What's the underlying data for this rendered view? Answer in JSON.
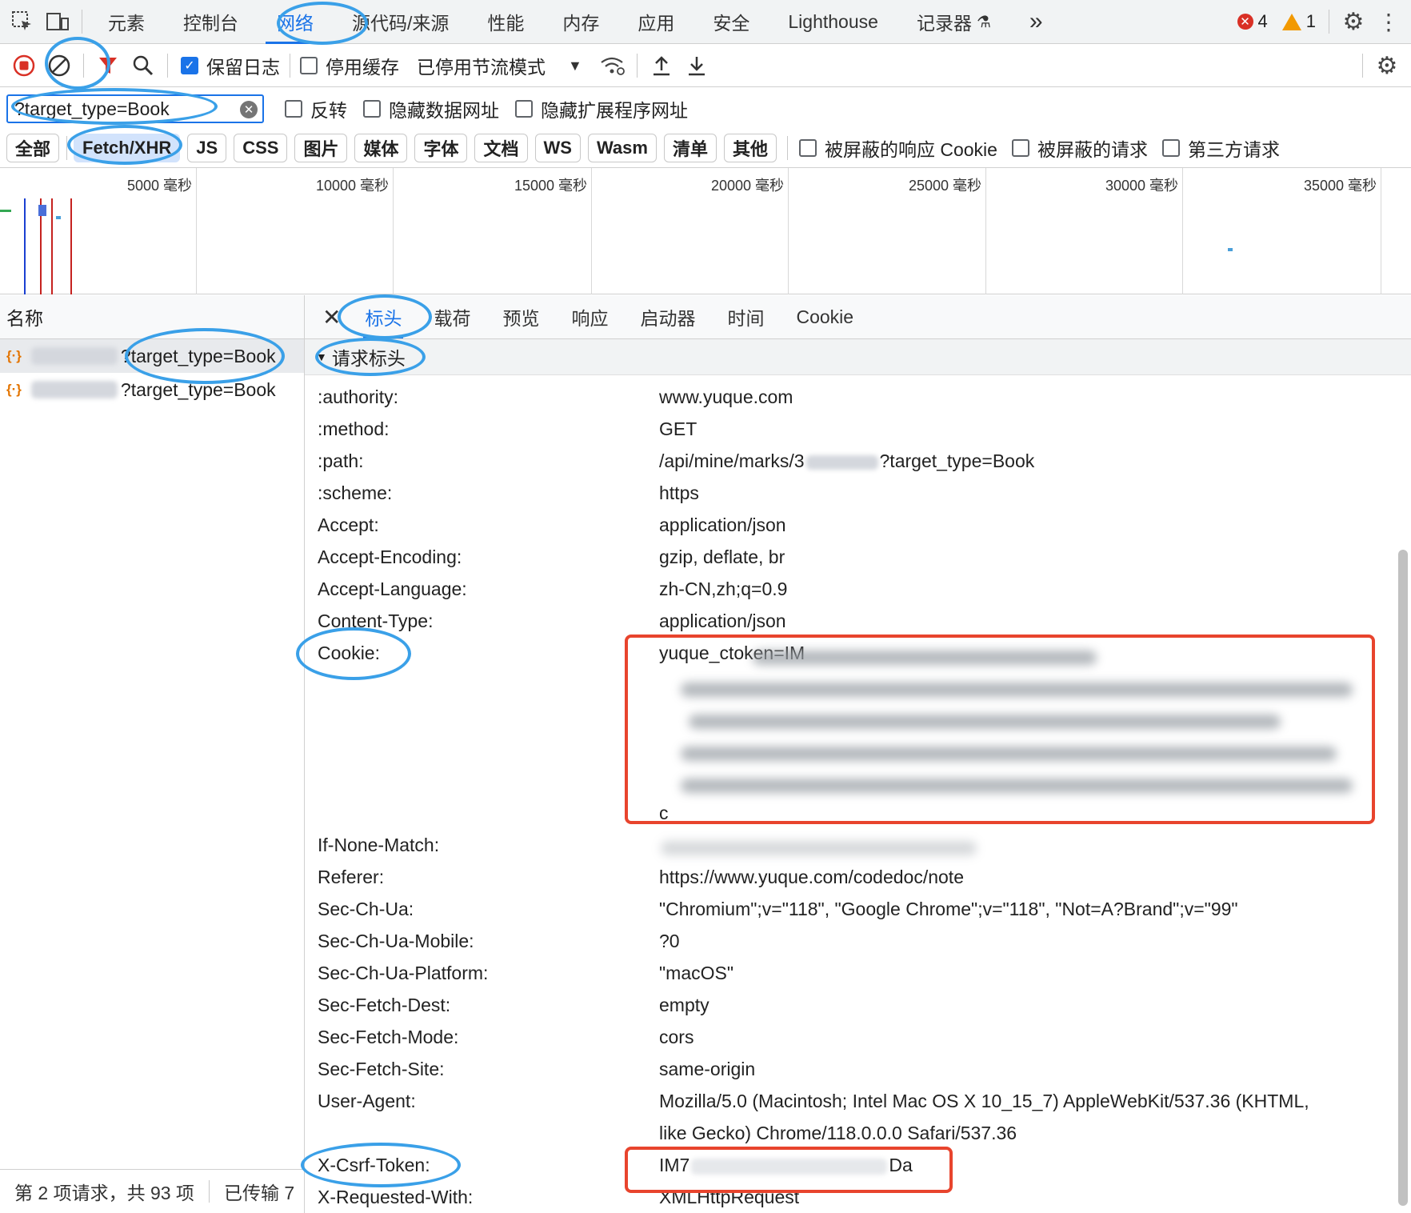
{
  "topbar": {
    "tabs": [
      "元素",
      "控制台",
      "网络",
      "源代码/来源",
      "性能",
      "内存",
      "应用",
      "安全",
      "Lighthouse",
      "记录器"
    ],
    "active_tab": "网络",
    "more": "»",
    "error_count": "4",
    "warning_count": "1"
  },
  "toolbar": {
    "preserve_log": "保留日志",
    "disable_cache": "停用缓存",
    "throttling": "已停用节流模式"
  },
  "filter": {
    "value": "?target_type=Book",
    "invert": "反转",
    "hide_data_urls": "隐藏数据网址",
    "hide_ext_urls": "隐藏扩展程序网址"
  },
  "types": {
    "chips": [
      "全部",
      "Fetch/XHR",
      "JS",
      "CSS",
      "图片",
      "媒体",
      "字体",
      "文档",
      "WS",
      "Wasm",
      "清单",
      "其他"
    ],
    "active": "Fetch/XHR",
    "blocked_cookies": "被屏蔽的响应 Cookie",
    "blocked_requests": "被屏蔽的请求",
    "third_party": "第三方请求"
  },
  "overview": {
    "ticks": [
      "5000 毫秒",
      "10000 毫秒",
      "15000 毫秒",
      "20000 毫秒",
      "25000 毫秒",
      "30000 毫秒",
      "35000 毫秒"
    ]
  },
  "left_panel": {
    "header": "名称",
    "requests": [
      {
        "name": "?target_type=Book"
      },
      {
        "name": "?target_type=Book"
      }
    ],
    "status": "第 2 项请求，共 93 项",
    "transferred": "已传输 7"
  },
  "details": {
    "tabs": [
      "标头",
      "载荷",
      "预览",
      "响应",
      "启动器",
      "时间",
      "Cookie"
    ],
    "active_tab": "标头",
    "section": "请求标头",
    "headers": [
      {
        "name": ":authority:",
        "value": "www.yuque.com"
      },
      {
        "name": ":method:",
        "value": "GET"
      },
      {
        "name": ":path:",
        "value": "/api/mine/marks/3"
      },
      {
        "name": ":scheme:",
        "value": "https"
      },
      {
        "name": "Accept:",
        "value": "application/json"
      },
      {
        "name": "Accept-Encoding:",
        "value": "gzip, deflate, br"
      },
      {
        "name": "Accept-Language:",
        "value": "zh-CN,zh;q=0.9"
      },
      {
        "name": "Content-Type:",
        "value": "application/json"
      },
      {
        "name": "Cookie:",
        "value": "yuque_ctoken=IM"
      },
      {
        "name": "If-None-Match:",
        "value": ""
      },
      {
        "name": "Referer:",
        "value": "https://www.yuque.com/codedoc/note"
      },
      {
        "name": "Sec-Ch-Ua:",
        "value": "\"Chromium\";v=\"118\", \"Google Chrome\";v=\"118\", \"Not=A?Brand\";v=\"99\""
      },
      {
        "name": "Sec-Ch-Ua-Mobile:",
        "value": "?0"
      },
      {
        "name": "Sec-Ch-Ua-Platform:",
        "value": "\"macOS\""
      },
      {
        "name": "Sec-Fetch-Dest:",
        "value": "empty"
      },
      {
        "name": "Sec-Fetch-Mode:",
        "value": "cors"
      },
      {
        "name": "Sec-Fetch-Site:",
        "value": "same-origin"
      },
      {
        "name": "User-Agent:",
        "value": "Mozilla/5.0 (Macintosh; Intel Mac OS X 10_15_7) AppleWebKit/537.36 (KHTML,"
      },
      {
        "name": "X-Csrf-Token:",
        "value": "IM7"
      },
      {
        "name": "X-Requested-With:",
        "value": "XMLHttpRequest"
      }
    ],
    "path_suffix": "?target_type=Book",
    "cookie_tail": "c",
    "user_agent_cont": "like Gecko) Chrome/118.0.0.0 Safari/537.36",
    "csrf_tail": "Da"
  },
  "colors": {
    "accent": "#1a73e8",
    "annotation_ellipse": "#3aa0e8",
    "annotation_box": "#e8442d",
    "error": "#d93025",
    "warning": "#f29900"
  }
}
